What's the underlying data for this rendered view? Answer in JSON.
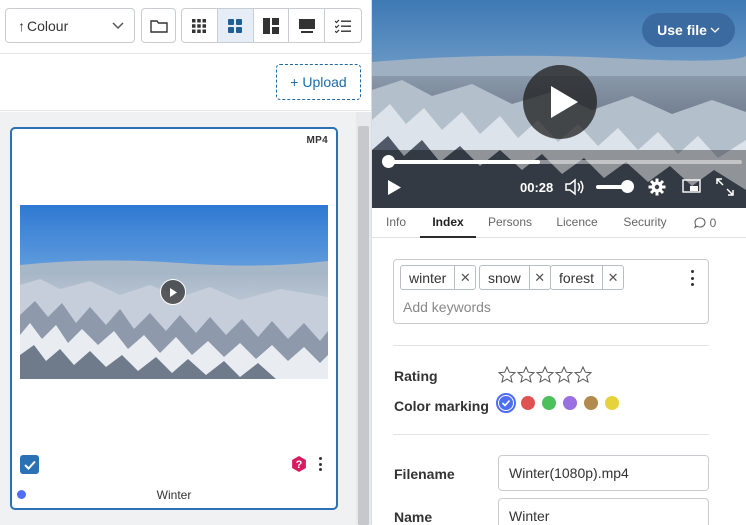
{
  "toolbar": {
    "sort_label": "Colour",
    "upload_label": "+ Upload",
    "view_modes": [
      "small-grid",
      "medium-grid",
      "masonry",
      "large-thumbnail",
      "list"
    ],
    "active_view": "medium-grid"
  },
  "asset_card": {
    "type_badge": "MP4",
    "name": "Winter",
    "selected": true,
    "color_marking": "#4f6ef5"
  },
  "player": {
    "use_file_label": "Use file",
    "time": "00:28",
    "progress": 0.43,
    "volume": 0.9
  },
  "tabs": [
    {
      "label": "Info"
    },
    {
      "label": "Index"
    },
    {
      "label": "Persons"
    },
    {
      "label": "Licence"
    },
    {
      "label": "Security"
    },
    {
      "label": "0"
    }
  ],
  "active_tab": "Index",
  "keywords": {
    "chips": [
      "winter",
      "snow",
      "forest"
    ],
    "placeholder": "Add keywords"
  },
  "rating": {
    "label": "Rating",
    "value": 0,
    "max": 5
  },
  "color_marking": {
    "label": "Color marking",
    "selected": "#4f6ef5",
    "options": [
      "#4f6ef5",
      "#e05252",
      "#4cc05a",
      "#9a6fe0",
      "#b38a4e",
      "#e6d23a"
    ]
  },
  "fields": {
    "filename_label": "Filename",
    "filename_value": "Winter(1080p).mp4",
    "name_label": "Name",
    "name_value": "Winter"
  }
}
